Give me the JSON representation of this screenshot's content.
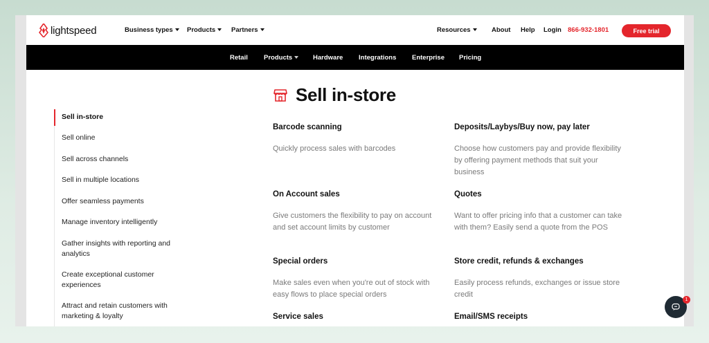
{
  "brand": {
    "name": "lightspeed",
    "accent": "#e4262c"
  },
  "topnav": {
    "business_types": "Business types",
    "products": "Products",
    "partners": "Partners",
    "resources": "Resources",
    "about": "About",
    "help": "Help",
    "login": "Login",
    "phone": "866-932-1801",
    "trial": "Free trial"
  },
  "subnav": {
    "retail": "Retail",
    "products": "Products",
    "hardware": "Hardware",
    "integrations": "Integrations",
    "enterprise": "Enterprise",
    "pricing": "Pricing"
  },
  "heading": "Sell in-store",
  "sidebar": {
    "items": [
      "Sell in-store",
      "Sell online",
      "Sell across channels",
      "Sell in multiple locations",
      "Offer seamless payments",
      "Manage inventory intelligently",
      "Gather insights with reporting and analytics",
      "Create exceptional customer experiences",
      "Attract and retain customers with marketing & loyalty"
    ],
    "active": "Sell in-store"
  },
  "features": [
    {
      "title": "Barcode scanning",
      "desc": "Quickly process sales with barcodes"
    },
    {
      "title": "Deposits/Laybys/Buy now, pay later",
      "desc": "Choose how customers pay and provide flexibility by offering payment methods that suit your business"
    },
    {
      "title": "On Account sales",
      "desc": "Give customers the flexibility to pay on account and set account limits by customer"
    },
    {
      "title": "Quotes",
      "desc": "Want to offer pricing info that a customer can take with them? Easily send a quote from the POS"
    },
    {
      "title": "Special orders",
      "desc": "Make sales even when you're out of stock with easy flows to place special orders"
    },
    {
      "title": "Store credit, refunds & exchanges",
      "desc": "Easily process refunds, exchanges or issue store credit"
    },
    {
      "title": "Service sales",
      "desc": ""
    },
    {
      "title": "Email/SMS receipts",
      "desc": ""
    }
  ],
  "chat": {
    "badge": "1"
  }
}
